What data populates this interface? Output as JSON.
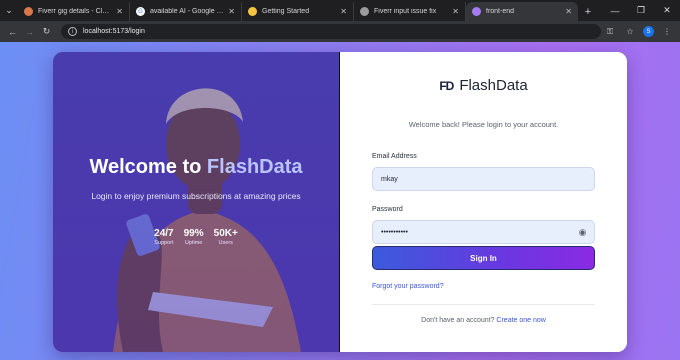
{
  "browser": {
    "tabs": [
      {
        "label": "Fiverr gig details - Claude",
        "favicon_color": "#d9774b",
        "active": false
      },
      {
        "label": "available AI - Google Search",
        "favicon_color": "#ffffff",
        "active": false
      },
      {
        "label": "Getting Started",
        "favicon_color": "#f5c542",
        "active": false
      },
      {
        "label": "Fiverr input issue fix",
        "favicon_color": "#9b9b9b",
        "active": false
      },
      {
        "label": "front-end",
        "favicon_color": "#a57cf0",
        "active": true
      }
    ],
    "new_tab": "+",
    "address": "localhost:5173/login",
    "profile_initial": "S"
  },
  "hero": {
    "title_prefix": "Welcome to ",
    "title_brand": "FlashData",
    "subtitle": "Login to enjoy premium subscriptions at amazing prices",
    "stats": [
      {
        "value": "24/7",
        "label": "Support"
      },
      {
        "value": "99%",
        "label": "Uptime"
      },
      {
        "value": "50K+",
        "label": "Users"
      }
    ]
  },
  "form": {
    "logo_mark": "FD",
    "logo_text": "FlashData",
    "welcome": "Welcome back! Please login to your account.",
    "email_label": "Email Address",
    "email_value": "mkay",
    "password_label": "Password",
    "password_value": "•••••••••••",
    "sign_in": "Sign In",
    "forgot": "Forgot your password?",
    "no_account": "Don't have an account? ",
    "create": "Create one now"
  },
  "colors": {
    "accent": "#3b55d6",
    "button_start": "#3b5bdb",
    "button_end": "#8a2be2"
  }
}
